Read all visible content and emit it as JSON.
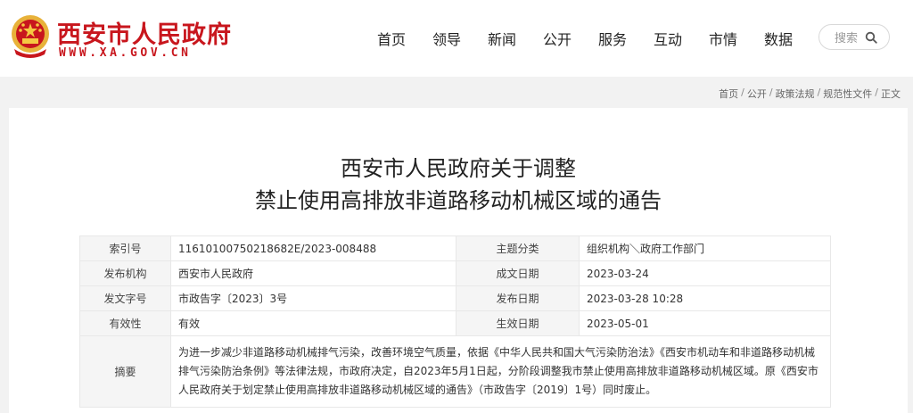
{
  "site": {
    "title": "西安市人民政府",
    "url": "WWW.XA.GOV.CN",
    "colors": {
      "brand": "#c8161d",
      "emblem_gold": "#e8b23a"
    },
    "emblem_icon": "national-emblem-icon"
  },
  "nav": {
    "items": [
      "首页",
      "领导",
      "新闻",
      "公开",
      "服务",
      "互动",
      "市情",
      "数据"
    ]
  },
  "search": {
    "label": "搜索",
    "icon": "search-icon"
  },
  "breadcrumb": {
    "items": [
      "首页",
      "公开",
      "政策法规",
      "规范性文件",
      "正文"
    ],
    "separator": "/"
  },
  "document": {
    "title_line1": "西安市人民政府关于调整",
    "title_line2": "禁止使用高排放非道路移动机械区域的通告",
    "meta": {
      "index_label": "索引号",
      "index_value": "11610100750218682E/2023-008488",
      "category_label": "主题分类",
      "category_value": "组织机构＼政府工作部门",
      "issuer_label": "发布机构",
      "issuer_value": "西安市人民政府",
      "written_label": "成文日期",
      "written_value": "2023-03-24",
      "docno_label": "发文字号",
      "docno_value": "市政告字〔2023〕3号",
      "published_label": "发布日期",
      "published_value": "2023-03-28 10:28",
      "validity_label": "有效性",
      "validity_value": "有效",
      "effective_label": "生效日期",
      "effective_value": "2023-05-01",
      "abstract_label": "摘要",
      "abstract_value": "为进一步减少非道路移动机械排气污染，改善环境空气质量，依据《中华人民共和国大气污染防治法》《西安市机动车和非道路移动机械排气污染防治条例》等法律法规，市政府决定，自2023年5月1日起，分阶段调整我市禁止使用高排放非道路移动机械区域。原《西安市人民政府关于划定禁止使用高排放非道路移动机械区域的通告》（市政告字〔2019〕1号）同时废止。"
    }
  }
}
